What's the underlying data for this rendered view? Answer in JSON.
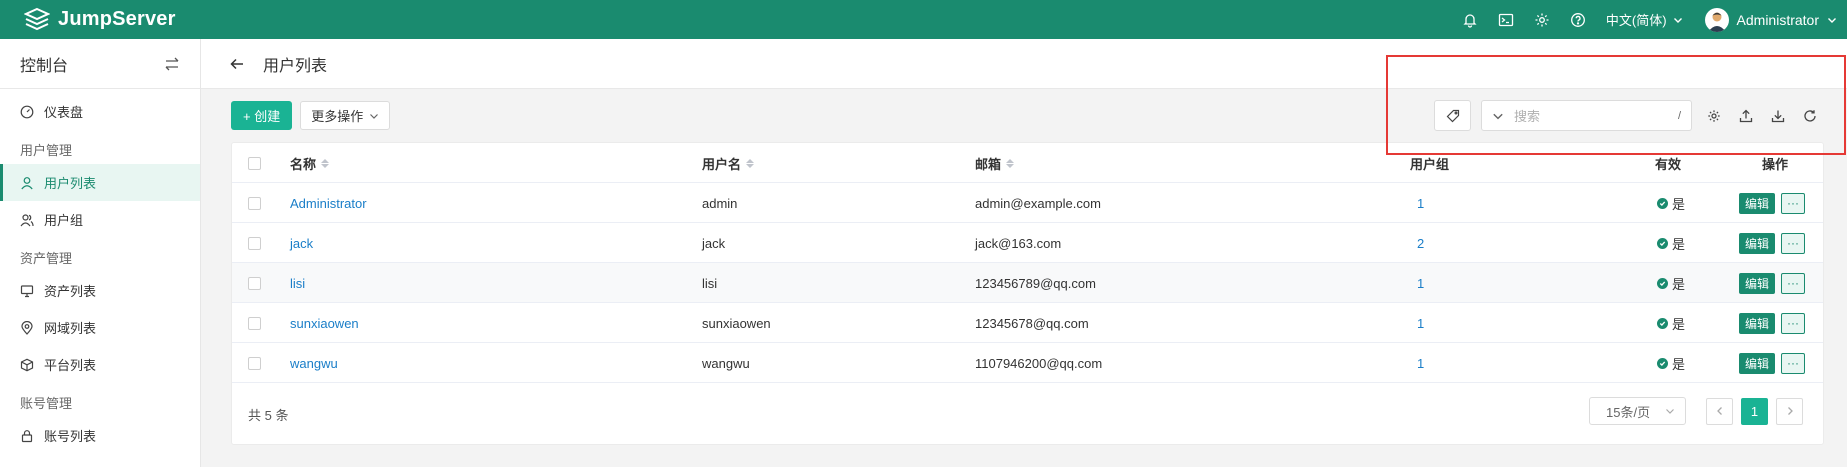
{
  "header": {
    "brand": "JumpServer",
    "language": "中文(简体)",
    "username": "Administrator"
  },
  "sidebar": {
    "title": "控制台",
    "items": [
      {
        "type": "item",
        "label": "仪表盘",
        "icon": "dashboard-icon"
      },
      {
        "type": "group",
        "label": "用户管理"
      },
      {
        "type": "item",
        "label": "用户列表",
        "icon": "user-icon",
        "active": true
      },
      {
        "type": "item",
        "label": "用户组",
        "icon": "users-icon"
      },
      {
        "type": "group",
        "label": "资产管理"
      },
      {
        "type": "item",
        "label": "资产列表",
        "icon": "monitor-icon"
      },
      {
        "type": "item",
        "label": "网域列表",
        "icon": "location-icon"
      },
      {
        "type": "item",
        "label": "平台列表",
        "icon": "cube-icon"
      },
      {
        "type": "group",
        "label": "账号管理"
      },
      {
        "type": "item",
        "label": "账号列表",
        "icon": "lock-icon"
      }
    ]
  },
  "page": {
    "title": "用户列表"
  },
  "toolbar": {
    "create_label": "+ 创建",
    "more_label": "更多操作",
    "search_placeholder": "搜索",
    "search_shortcut": "/"
  },
  "table": {
    "columns": {
      "name": "名称",
      "username": "用户名",
      "email": "邮箱",
      "groups": "用户组",
      "valid": "有效",
      "actions": "操作"
    },
    "rows": [
      {
        "name": "Administrator",
        "username": "admin",
        "email": "admin@example.com",
        "groups": "1",
        "valid": "是"
      },
      {
        "name": "jack",
        "username": "jack",
        "email": "jack@163.com",
        "groups": "2",
        "valid": "是"
      },
      {
        "name": "lisi",
        "username": "lisi",
        "email": "123456789@qq.com",
        "groups": "1",
        "valid": "是"
      },
      {
        "name": "sunxiaowen",
        "username": "sunxiaowen",
        "email": "12345678@qq.com",
        "groups": "1",
        "valid": "是"
      },
      {
        "name": "wangwu",
        "username": "wangwu",
        "email": "1107946200@qq.com",
        "groups": "1",
        "valid": "是"
      }
    ],
    "edit_label": "编辑",
    "more_label": "···"
  },
  "footer": {
    "total": "共 5 条",
    "page_size": "15条/页",
    "current_page": "1"
  },
  "colors": {
    "brand": "#1a8b6f",
    "primary_button": "#1ab394",
    "link": "#1a7ec8",
    "highlight_box": "#e53935"
  }
}
